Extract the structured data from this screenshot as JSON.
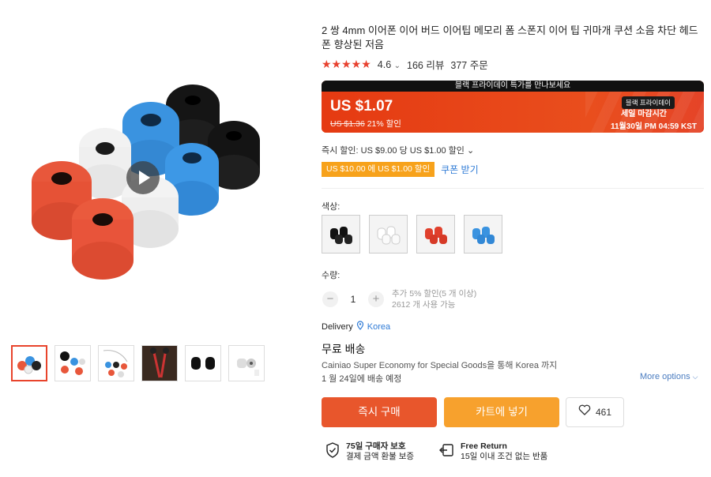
{
  "product": {
    "title": "2 쌍 4mm 이어폰 이어 버드 이어팁 메모리 폼 스폰지 이어 팁 귀마개 쿠션 소음 차단 헤드폰 향상된 저음",
    "rating": "4.6",
    "rating_arrow": "⌄",
    "reviews": "166 리뷰",
    "orders": "377 주문"
  },
  "promo": {
    "banner": "블랙 프라이데이 특가를 만나보세요",
    "price": "US $1.07",
    "old_price": "US $1.36",
    "discount": "21% 할인",
    "badge": "블랙 프라이데이",
    "deadline_label": "세일 마감시간",
    "deadline_time": "11월30일 PM 04:59 KST"
  },
  "instant_discount": "즉시 할인: US $9.00 당 US $1.00 할인 ⌄",
  "coupon": {
    "tag": "US $10.00 에 US $1.00 할인",
    "link": "쿠폰 받기"
  },
  "color_label": "색상:",
  "quantity": {
    "label": "수량:",
    "value": "1",
    "minus": "−",
    "plus": "+",
    "info1": "추가 5% 할인(5 개 이상)",
    "info2": "2612 개 사용 가능"
  },
  "delivery": {
    "label": "Delivery",
    "location": "Korea",
    "shipping_title": "무료 배송",
    "shipping_line": "Cainiao Super Economy for Special Goods을 통해 Korea 까지",
    "eta": "1 월 24일에 배송 예정",
    "more_options": "More options"
  },
  "buttons": {
    "buy": "즉시 구매",
    "cart": "카트에 넣기",
    "wish_count": "461"
  },
  "guarantees": [
    {
      "title": "75일 구매자 보호",
      "sub": "결제 금액 환불 보증"
    },
    {
      "title": "Free Return",
      "sub": "15일 이내 조건 없는 반품"
    }
  ],
  "colors": {
    "accent": "#e8562c",
    "cart": "#f7a12d",
    "star": "#e8412f",
    "link": "#2f7bd6"
  }
}
